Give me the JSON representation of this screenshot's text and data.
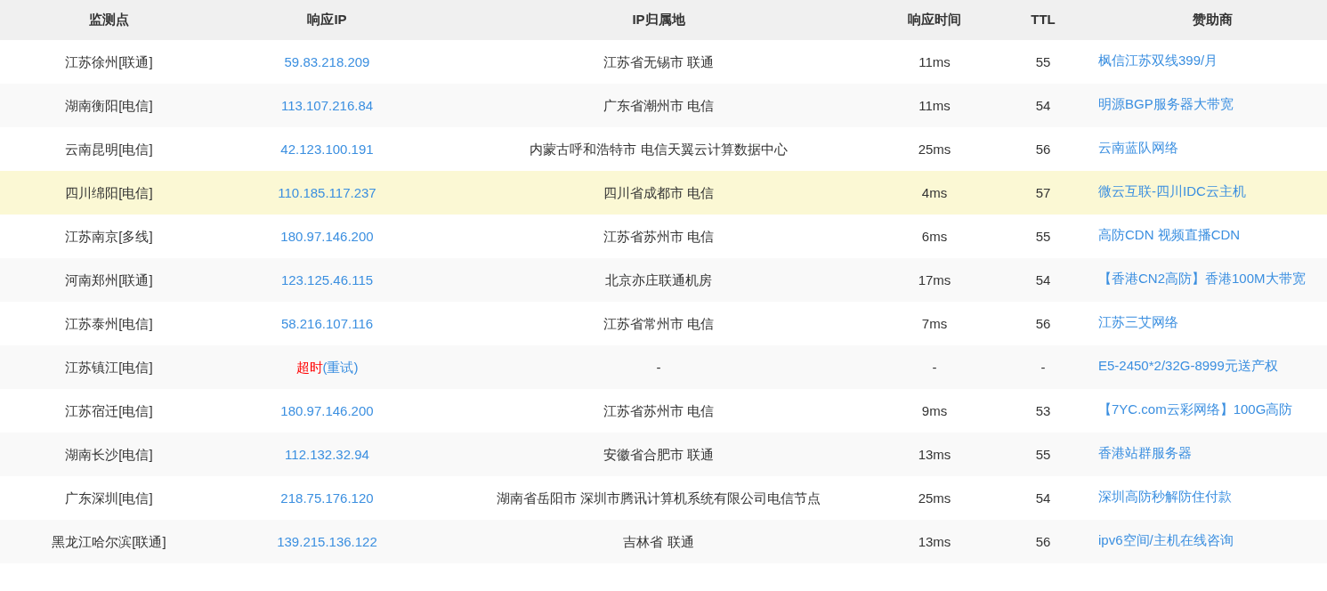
{
  "columns": [
    "监测点",
    "响应IP",
    "IP归属地",
    "响应时间",
    "TTL",
    "赞助商"
  ],
  "rows": [
    {
      "node": "江苏徐州[联通]",
      "ip": {
        "kind": "ok",
        "text": "59.83.218.209"
      },
      "location": "江苏省无锡市 联通",
      "time": "11ms",
      "ttl": "55",
      "sponsor": "枫信江苏双线399/月",
      "highlighted": false
    },
    {
      "node": "湖南衡阳[电信]",
      "ip": {
        "kind": "ok",
        "text": "113.107.216.84"
      },
      "location": "广东省潮州市 电信",
      "time": "11ms",
      "ttl": "54",
      "sponsor": "明源BGP服务器大带宽",
      "highlighted": false
    },
    {
      "node": "云南昆明[电信]",
      "ip": {
        "kind": "ok",
        "text": "42.123.100.191"
      },
      "location": "内蒙古呼和浩特市 电信天翼云计算数据中心",
      "time": "25ms",
      "ttl": "56",
      "sponsor": "云南蓝队网络",
      "highlighted": false
    },
    {
      "node": "四川绵阳[电信]",
      "ip": {
        "kind": "ok",
        "text": "110.185.117.237"
      },
      "location": "四川省成都市 电信",
      "time": "4ms",
      "ttl": "57",
      "sponsor": "微云互联-四川IDC云主机",
      "highlighted": true
    },
    {
      "node": "江苏南京[多线]",
      "ip": {
        "kind": "ok",
        "text": "180.97.146.200"
      },
      "location": "江苏省苏州市 电信",
      "time": "6ms",
      "ttl": "55",
      "sponsor": "高防CDN 视频直播CDN",
      "highlighted": false
    },
    {
      "node": "河南郑州[联通]",
      "ip": {
        "kind": "ok",
        "text": "123.125.46.115"
      },
      "location": "北京亦庄联通机房",
      "time": "17ms",
      "ttl": "54",
      "sponsor": "【香港CN2高防】香港100M大带宽",
      "highlighted": false
    },
    {
      "node": "江苏泰州[电信]",
      "ip": {
        "kind": "ok",
        "text": "58.216.107.116"
      },
      "location": "江苏省常州市 电信",
      "time": "7ms",
      "ttl": "56",
      "sponsor": "江苏三艾网络",
      "highlighted": false
    },
    {
      "node": "江苏镇江[电信]",
      "ip": {
        "kind": "timeout",
        "text": "超时",
        "retry": "(重试)"
      },
      "location": "-",
      "time": "-",
      "ttl": "-",
      "sponsor": "E5-2450*2/32G-8999元送产权",
      "highlighted": false
    },
    {
      "node": "江苏宿迁[电信]",
      "ip": {
        "kind": "ok",
        "text": "180.97.146.200"
      },
      "location": "江苏省苏州市 电信",
      "time": "9ms",
      "ttl": "53",
      "sponsor": "【7YC.com云彩网络】100G高防",
      "highlighted": false
    },
    {
      "node": "湖南长沙[电信]",
      "ip": {
        "kind": "ok",
        "text": "112.132.32.94"
      },
      "location": "安徽省合肥市 联通",
      "time": "13ms",
      "ttl": "55",
      "sponsor": "香港站群服务器",
      "highlighted": false
    },
    {
      "node": "广东深圳[电信]",
      "ip": {
        "kind": "ok",
        "text": "218.75.176.120"
      },
      "location": "湖南省岳阳市 深圳市腾讯计算机系统有限公司电信节点",
      "time": "25ms",
      "ttl": "54",
      "sponsor": "深圳高防秒解防住付款",
      "highlighted": false
    },
    {
      "node": "黑龙江哈尔滨[联通]",
      "ip": {
        "kind": "ok",
        "text": "139.215.136.122"
      },
      "location": "吉林省 联通",
      "time": "13ms",
      "ttl": "56",
      "sponsor": "ipv6空间/主机在线咨询",
      "highlighted": false
    }
  ]
}
